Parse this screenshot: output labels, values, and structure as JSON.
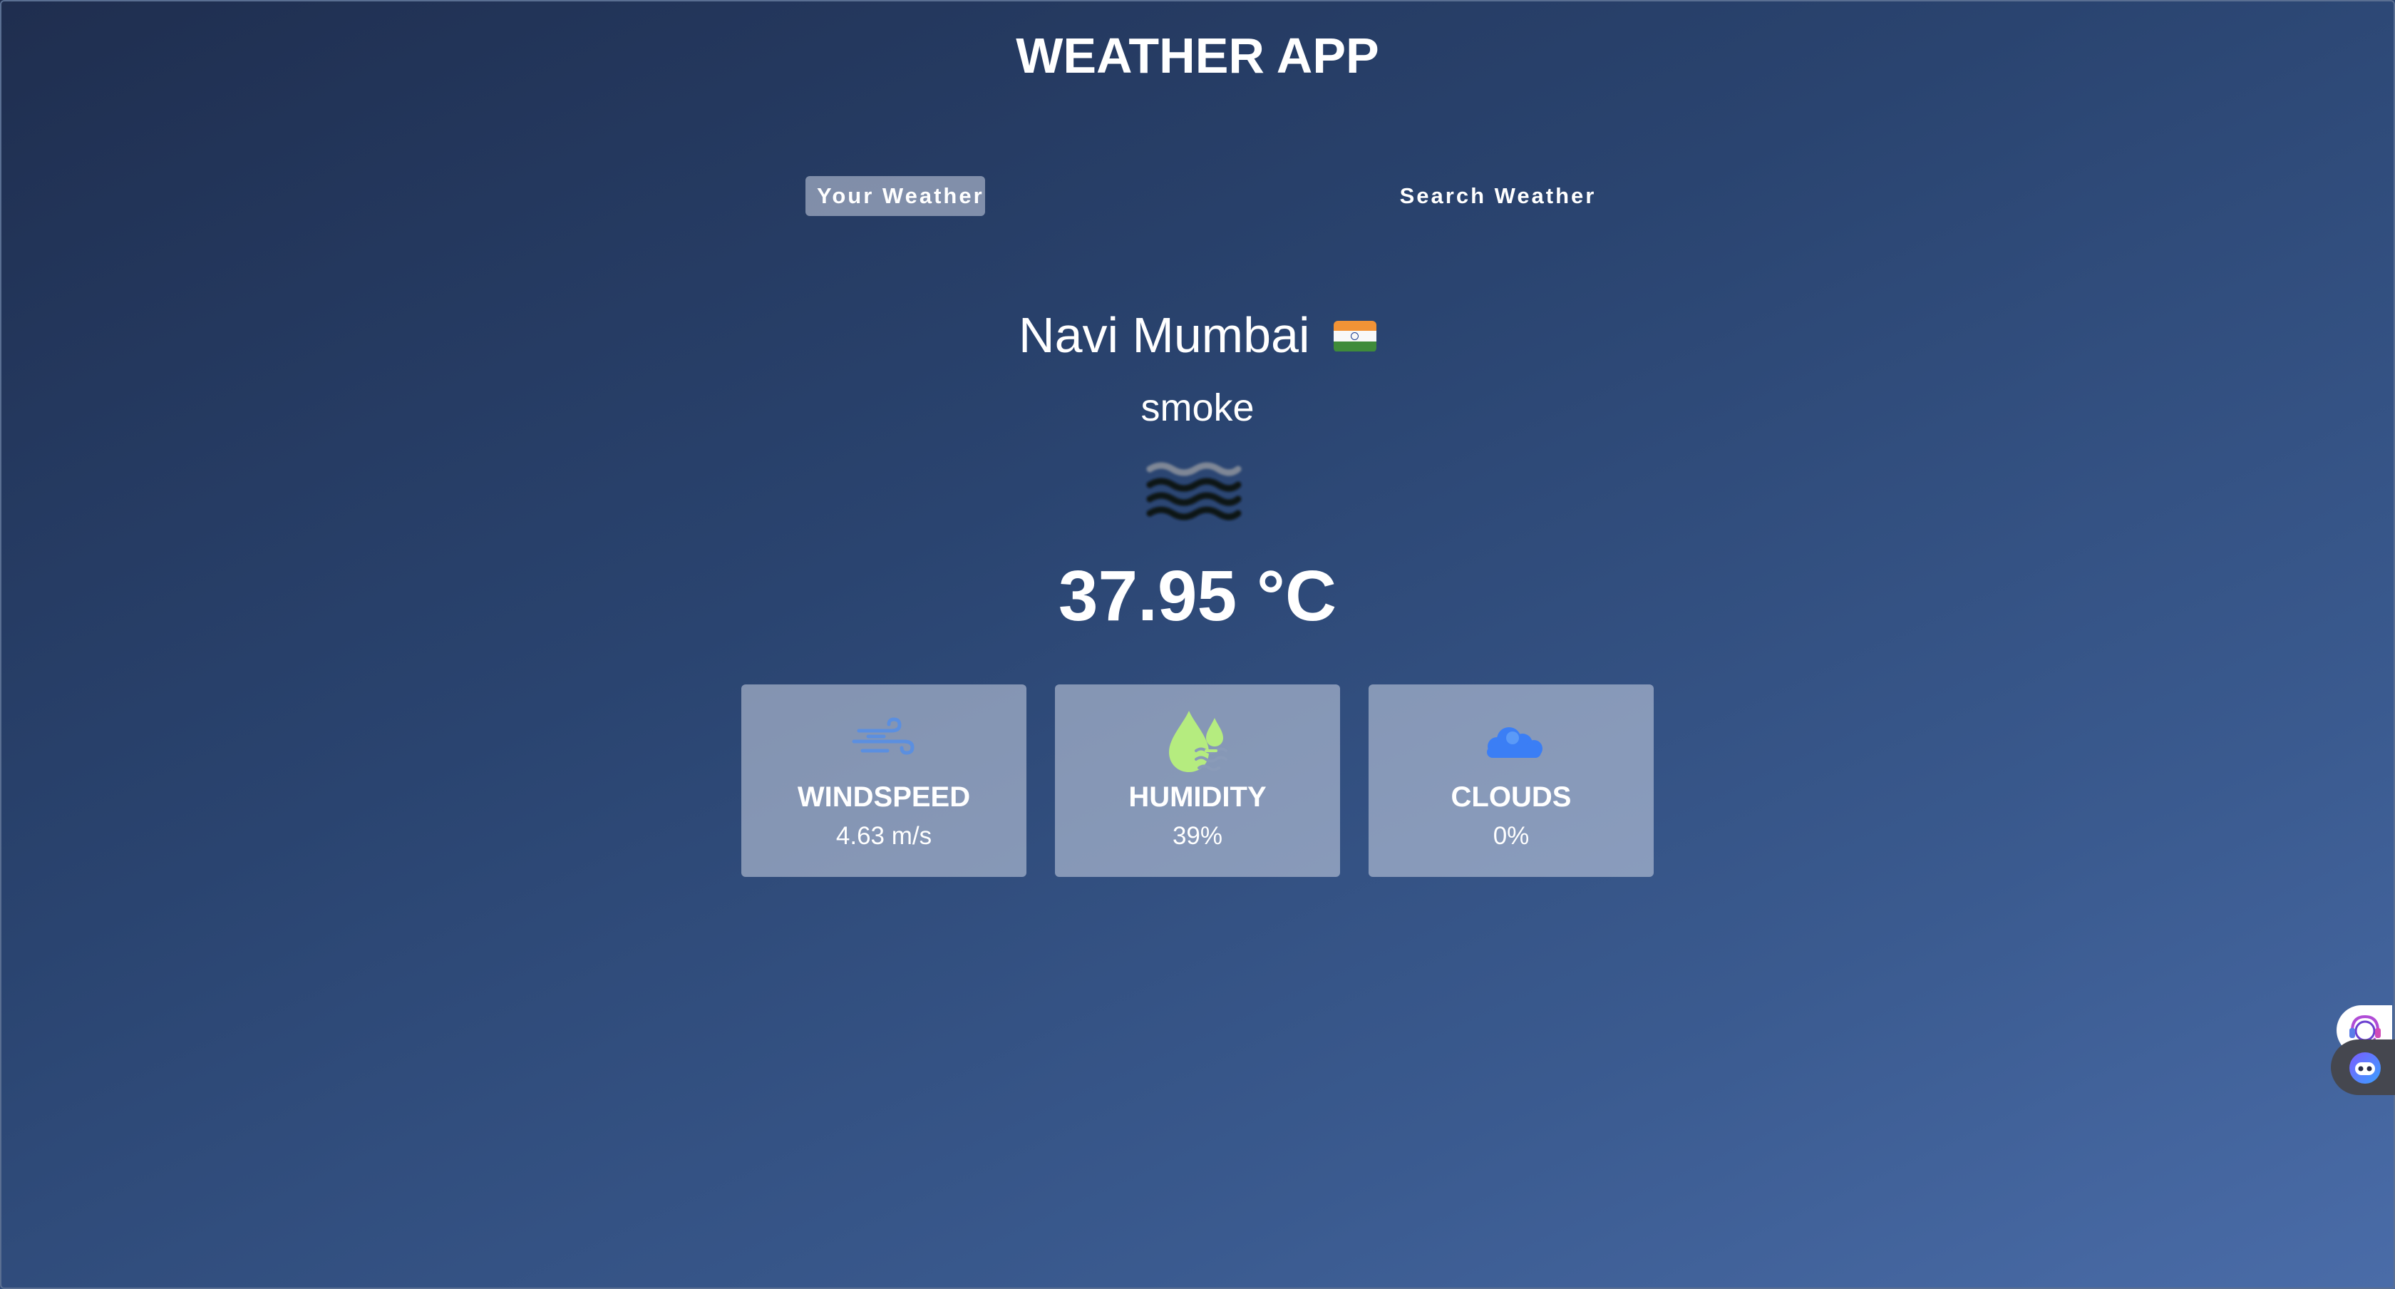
{
  "header": {
    "title": "WEATHER APP"
  },
  "tabs": [
    {
      "label": "Your Weather",
      "active": true
    },
    {
      "label": "Search Weather",
      "active": false
    }
  ],
  "location": {
    "city": "Navi Mumbai",
    "country_flag": "india-flag-icon"
  },
  "weather": {
    "description": "smoke",
    "icon": "smoke-haze-icon",
    "temperature": "37.95 °C"
  },
  "stats": [
    {
      "label": "WINDSPEED",
      "value": "4.63 m/s",
      "icon": "wind-icon"
    },
    {
      "label": "HUMIDITY",
      "value": "39%",
      "icon": "humidity-drops-icon"
    },
    {
      "label": "CLOUDS",
      "value": "0%",
      "icon": "cloud-icon"
    }
  ],
  "floating_widgets": [
    {
      "icon": "support-headset-icon"
    },
    {
      "icon": "chat-bot-icon"
    }
  ],
  "colors": {
    "background_start": "#1f2e4f",
    "background_end": "#4a6ca8",
    "card_bg": "rgba(219,226,239,0.5)",
    "wind_icon": "#5b8fe0",
    "humidity_icon": "#b5ec7f",
    "cloud_icon": "#3b7ef5"
  }
}
